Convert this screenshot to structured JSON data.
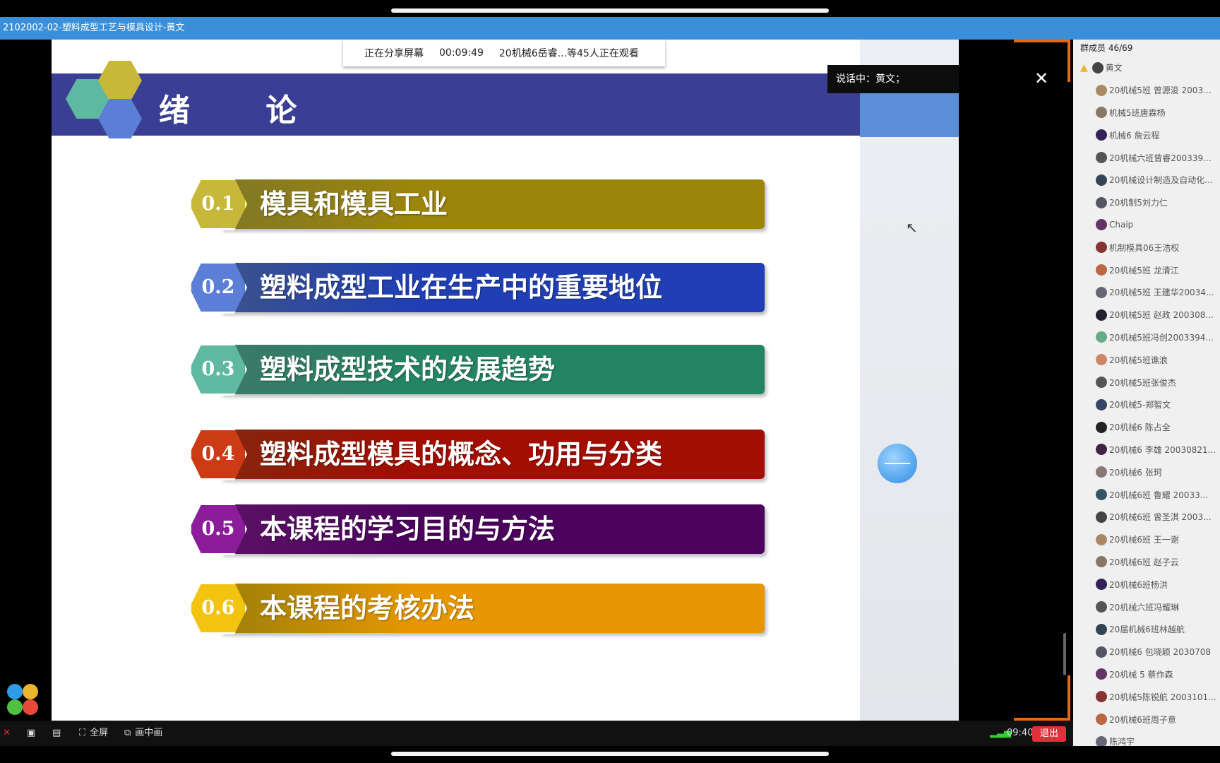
{
  "window": {
    "title": "2102002-02-塑料成型工艺与模具设计-黄文"
  },
  "share_bar": {
    "status": "正在分享屏幕",
    "elapsed": "00:09:49",
    "viewers": "20机械6岳睿...等45人正在观看"
  },
  "speaking": {
    "label": "说话中：黄文；"
  },
  "slide": {
    "title": "绪 论",
    "items": [
      {
        "num": "0.1",
        "text": "模具和模具工业",
        "color": "#c7b83a"
      },
      {
        "num": "0.2",
        "text": "塑料成型工业在生产中的重要地位",
        "color": "#5b7fd6"
      },
      {
        "num": "0.3",
        "text": "塑料成型技术的发展趋势",
        "color": "#5fb8a0"
      },
      {
        "num": "0.4",
        "text": "塑料成型模具的概念、功用与分类",
        "color": "#cc3a16"
      },
      {
        "num": "0.5",
        "text": "本课程的学习目的与方法",
        "color": "#8b1c9a"
      },
      {
        "num": "0.6",
        "text": "本课程的考核办法",
        "color": "#f2c40f"
      }
    ]
  },
  "bottom_bar": {
    "fullscreen_label": "全屏",
    "pip_label": "画中画",
    "time": "09:40",
    "exit_label": "退出"
  },
  "sidebar": {
    "header": "群成员 46/69",
    "members": [
      "黄文",
      "20机械5班 曾源浚 2003...",
      "机械5班唐霖杨",
      "机械6 詹云程",
      "20机械六班曾睿200339...",
      "20机械设计制造及自动化...",
      "20机制5刘力仁",
      "Chaip",
      "机制模具06王浩权",
      "20机械5班 龙清江",
      "20机械5班 王建华20034...",
      "20机械5班 赵政 200308...",
      "20机械5班冯创2003394...",
      "20机械5班谯浪",
      "20机械5班张俊杰",
      "20机械5-郑智文",
      "20机械6 陈占全",
      "20机械6 李雄 20030821...",
      "20机械6 张珂",
      "20机械6班 鲁耀 20033...",
      "20机械6班 曾圣淇 2003...",
      "20机械6班 王一谢",
      "20机械6班 赵子云",
      "20机械6班杨洪",
      "20机械六班冯耀琳",
      "20届机械6班林越航",
      "20机械6 包晓颖 2030708",
      "20机械 5 蔡作森",
      "20机械5陈锐航 2003101...",
      "20机械6班周子意",
      "陈鸿宇"
    ]
  }
}
